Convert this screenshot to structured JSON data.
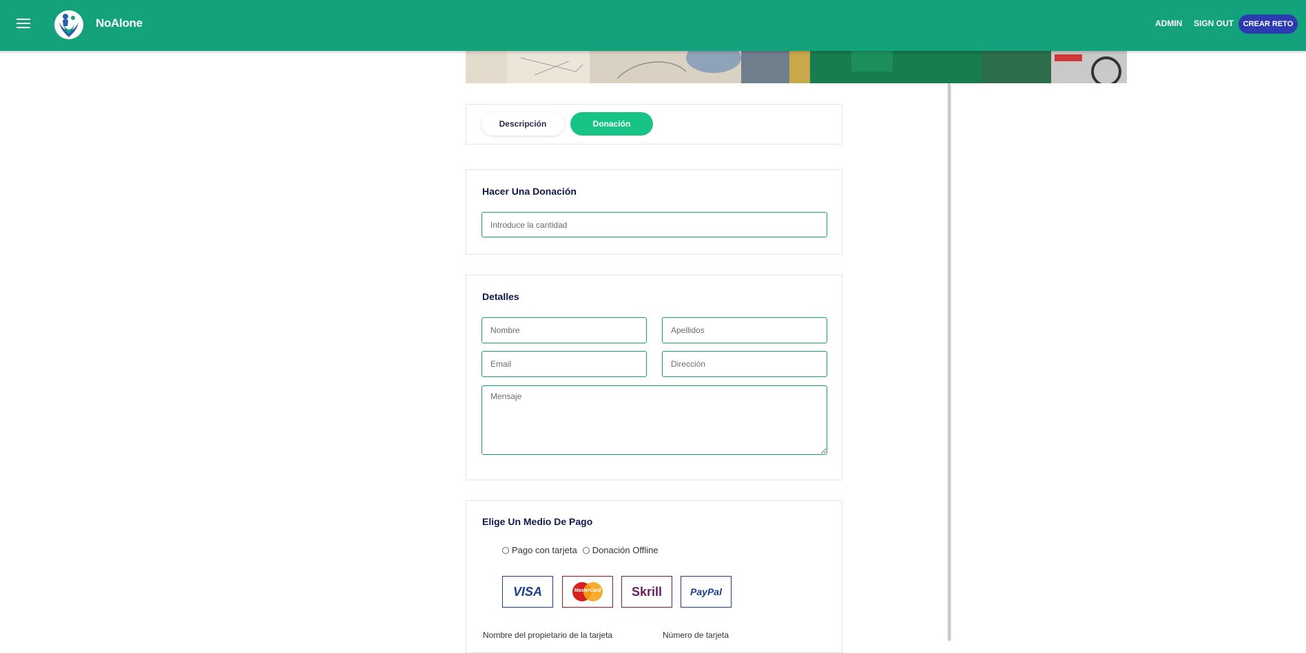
{
  "header": {
    "brand": "NoAlone",
    "nav": {
      "admin": "ADMIN",
      "sign_out": "SIGN OUT",
      "create": "CREAR RETO"
    },
    "colors": {
      "bar": "#14a27d",
      "create_button": "#2d3bb0"
    }
  },
  "tabs": {
    "description": "Descripción",
    "donation": "Donación",
    "active": "Donación",
    "active_color": "#18c485"
  },
  "donation": {
    "title": "Hacer Una Donación",
    "amount_placeholder": "Introduce la cantidad"
  },
  "details": {
    "title": "Detalles",
    "first_name_placeholder": "Nombre",
    "last_name_placeholder": "Apellidos",
    "email_placeholder": "Email",
    "address_placeholder": "Dirección",
    "message_placeholder": "Mensaje"
  },
  "payment": {
    "title": "Elige Un Medio De Pago",
    "options": [
      "Pago con tarjeta",
      "Donación Offline"
    ],
    "methods": [
      "VISA",
      "MasterCard",
      "Skrill",
      "PayPal"
    ],
    "card_holder_label": "Nombre del propietario de la tarjeta",
    "card_number_label": "Número de tarjeta"
  }
}
